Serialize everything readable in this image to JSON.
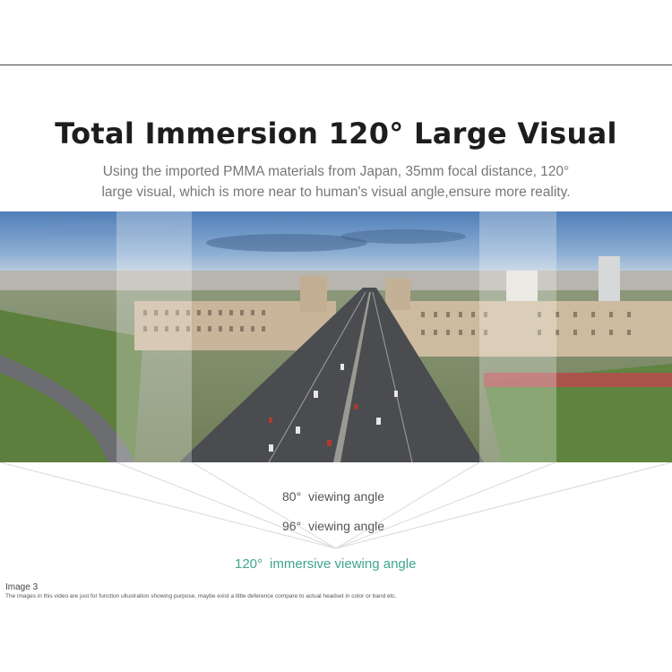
{
  "title": "Total Immersion 120° Large Visual",
  "subtitle_line1": "Using the imported PMMA materials from Japan, 35mm focal distance, 120°",
  "subtitle_line2": "large visual, which is more near to human's visual angle,ensure more reality.",
  "angles": [
    {
      "degree": "80°",
      "label": "viewing angle"
    },
    {
      "degree": "96°",
      "label": "viewing angle"
    },
    {
      "degree": "120°",
      "label": "immersive viewing angle"
    }
  ],
  "colors": {
    "accent_green": "#3fa68c",
    "title": "#1d1d1d",
    "subtitle": "#777777"
  },
  "image_caption": "Image 3",
  "disclaimer": "The images in this video are just for function ullustration showing purpose, maybe exist a little deference compare to actual headset in color or band etc."
}
